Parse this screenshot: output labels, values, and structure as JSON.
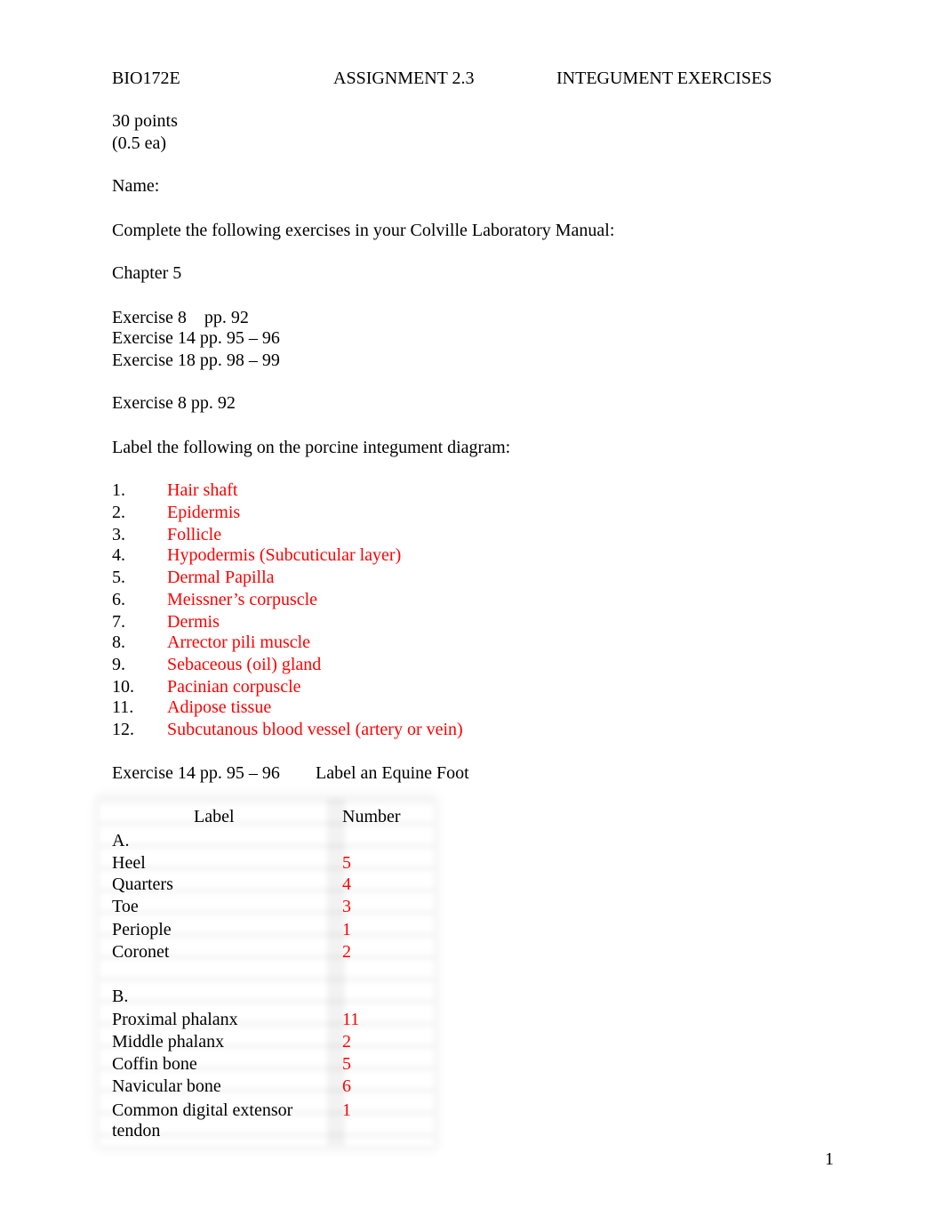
{
  "header": {
    "course": "BIO172E",
    "assignment": "ASSIGNMENT 2.3",
    "title": "INTEGUMENT EXERCISES"
  },
  "points": "30 points",
  "points_each": "(0.5 ea)",
  "name_label": "Name:",
  "instructions": "Complete the following exercises in your Colville Laboratory Manual:",
  "chapter": "Chapter 5",
  "exercise_list": [
    "Exercise 8    pp. 92",
    "Exercise 14 pp. 95 – 96",
    "Exercise 18 pp. 98 – 99"
  ],
  "exercise8": {
    "heading": "Exercise 8 pp. 92",
    "prompt": "Label the following on the porcine integument diagram:",
    "items": [
      {
        "num": "1.",
        "text": "Hair shaft"
      },
      {
        "num": "2.",
        "text": "Epidermis"
      },
      {
        "num": "3.",
        "text": "Follicle"
      },
      {
        "num": "4.",
        "text": "Hypodermis (Subcuticular layer)"
      },
      {
        "num": "5.",
        "text": "Dermal Papilla"
      },
      {
        "num": "6.",
        "text": "Meissner’s corpuscle"
      },
      {
        "num": "7.",
        "text": "Dermis"
      },
      {
        "num": "8.",
        "text": "Arrector pili muscle"
      },
      {
        "num": "9.",
        "text": "Sebaceous (oil) gland"
      },
      {
        "num": "10.",
        "text": "Pacinian corpuscle"
      },
      {
        "num": "11.",
        "text": "Adipose tissue"
      },
      {
        "num": "12.",
        "text": "Subcutanous blood vessel (artery or vein)"
      }
    ]
  },
  "exercise14": {
    "heading": "Exercise 14 pp. 95 – 96",
    "subtitle": "Label an Equine Foot",
    "table": {
      "headers": [
        "Label",
        "Number"
      ],
      "rows": [
        {
          "label": "A.",
          "number": ""
        },
        {
          "label": "Heel",
          "number": "5"
        },
        {
          "label": "Quarters",
          "number": "4"
        },
        {
          "label": "Toe",
          "number": "3"
        },
        {
          "label": "Periople",
          "number": "1"
        },
        {
          "label": "Coronet",
          "number": "2"
        },
        {
          "label": "",
          "number": ""
        },
        {
          "label": "B.",
          "number": ""
        },
        {
          "label": "Proximal phalanx",
          "number": "11"
        },
        {
          "label": "Middle phalanx",
          "number": "2"
        },
        {
          "label": "Coffin bone",
          "number": "5"
        },
        {
          "label": "Navicular bone",
          "number": "6"
        },
        {
          "label": "Common digital extensor",
          "label2": "tendon",
          "number": "1"
        }
      ]
    }
  },
  "colors": {
    "answer": "#ff0000",
    "text": "#000000"
  },
  "page_number": "1"
}
